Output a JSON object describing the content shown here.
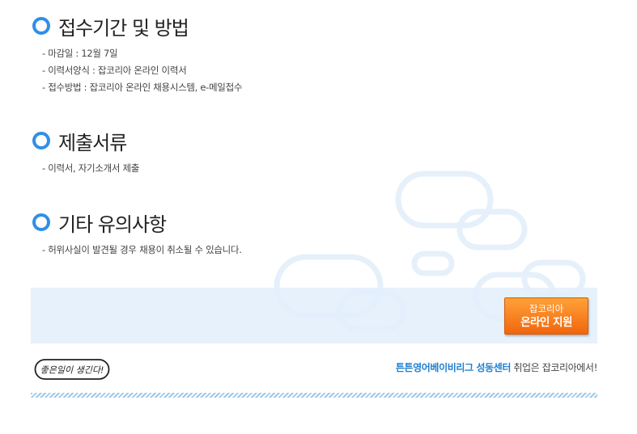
{
  "sections": [
    {
      "title": "접수기간 및 방법",
      "items": [
        "- 마감일 : 12월 7일",
        "- 이력서양식 : 잡코리아 온라인 이력서",
        "- 접수방법 : 잡코리아 온라인 채용시스템, e-메일접수"
      ]
    },
    {
      "title": "제출서류",
      "items": [
        "- 이력서, 자기소개서 제출"
      ]
    },
    {
      "title": "기타 유의사항",
      "items": [
        "- 허위사실이 발견될 경우 채용이 취소될 수 있습니다."
      ]
    }
  ],
  "apply_button": {
    "line1": "잡코리아",
    "line2": "온라인 지원"
  },
  "footer": {
    "logo_text": "좋은일이 생긴다!",
    "company_name": "튼튼영어베이비리그 성동센터",
    "tagline": " 취업은 잡코리아에서!"
  },
  "colors": {
    "accent_blue": "#2f8fe8",
    "button_orange": "#f1660c",
    "bar_background": "#e2eefc",
    "company_name": "#1f7fd0"
  },
  "icons": {
    "section_marker": "ring-bullet-icon"
  }
}
